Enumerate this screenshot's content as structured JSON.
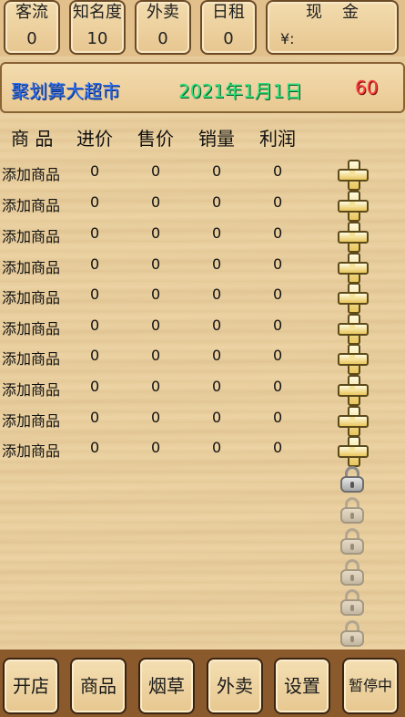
{
  "stats": [
    {
      "label": "客流",
      "value": "0"
    },
    {
      "label": "知名度",
      "value": "10"
    },
    {
      "label": "外卖",
      "value": "0"
    },
    {
      "label": "日租",
      "value": "0"
    },
    {
      "label": "现金",
      "value": "¥:"
    }
  ],
  "store": {
    "name": "聚划算大超市",
    "date": "2021年1月1日",
    "count": "60",
    "colors": {
      "name": "#2a6df0",
      "date": "#2ee07a",
      "count": "#ff3b3b"
    }
  },
  "columns": [
    "商 品",
    "进价",
    "售价",
    "销量",
    "利润"
  ],
  "rows": [
    {
      "name": "添加商品",
      "buy": "0",
      "sell": "0",
      "sold": "0",
      "profit": "0"
    },
    {
      "name": "添加商品",
      "buy": "0",
      "sell": "0",
      "sold": "0",
      "profit": "0"
    },
    {
      "name": "添加商品",
      "buy": "0",
      "sell": "0",
      "sold": "0",
      "profit": "0"
    },
    {
      "name": "添加商品",
      "buy": "0",
      "sell": "0",
      "sold": "0",
      "profit": "0"
    },
    {
      "name": "添加商品",
      "buy": "0",
      "sell": "0",
      "sold": "0",
      "profit": "0"
    },
    {
      "name": "添加商品",
      "buy": "0",
      "sell": "0",
      "sold": "0",
      "profit": "0"
    },
    {
      "name": "添加商品",
      "buy": "0",
      "sell": "0",
      "sold": "0",
      "profit": "0"
    },
    {
      "name": "添加商品",
      "buy": "0",
      "sell": "0",
      "sold": "0",
      "profit": "0"
    },
    {
      "name": "添加商品",
      "buy": "0",
      "sell": "0",
      "sold": "0",
      "profit": "0"
    },
    {
      "name": "添加商品",
      "buy": "0",
      "sell": "0",
      "sold": "0",
      "profit": "0"
    }
  ],
  "row_icon": "plus-icon",
  "locked_slot_icon": "lock-icon",
  "nav": [
    {
      "label": "开店"
    },
    {
      "label": "商品"
    },
    {
      "label": "烟草"
    },
    {
      "label": "外卖"
    },
    {
      "label": "设置"
    },
    {
      "label": "暂停中"
    }
  ]
}
